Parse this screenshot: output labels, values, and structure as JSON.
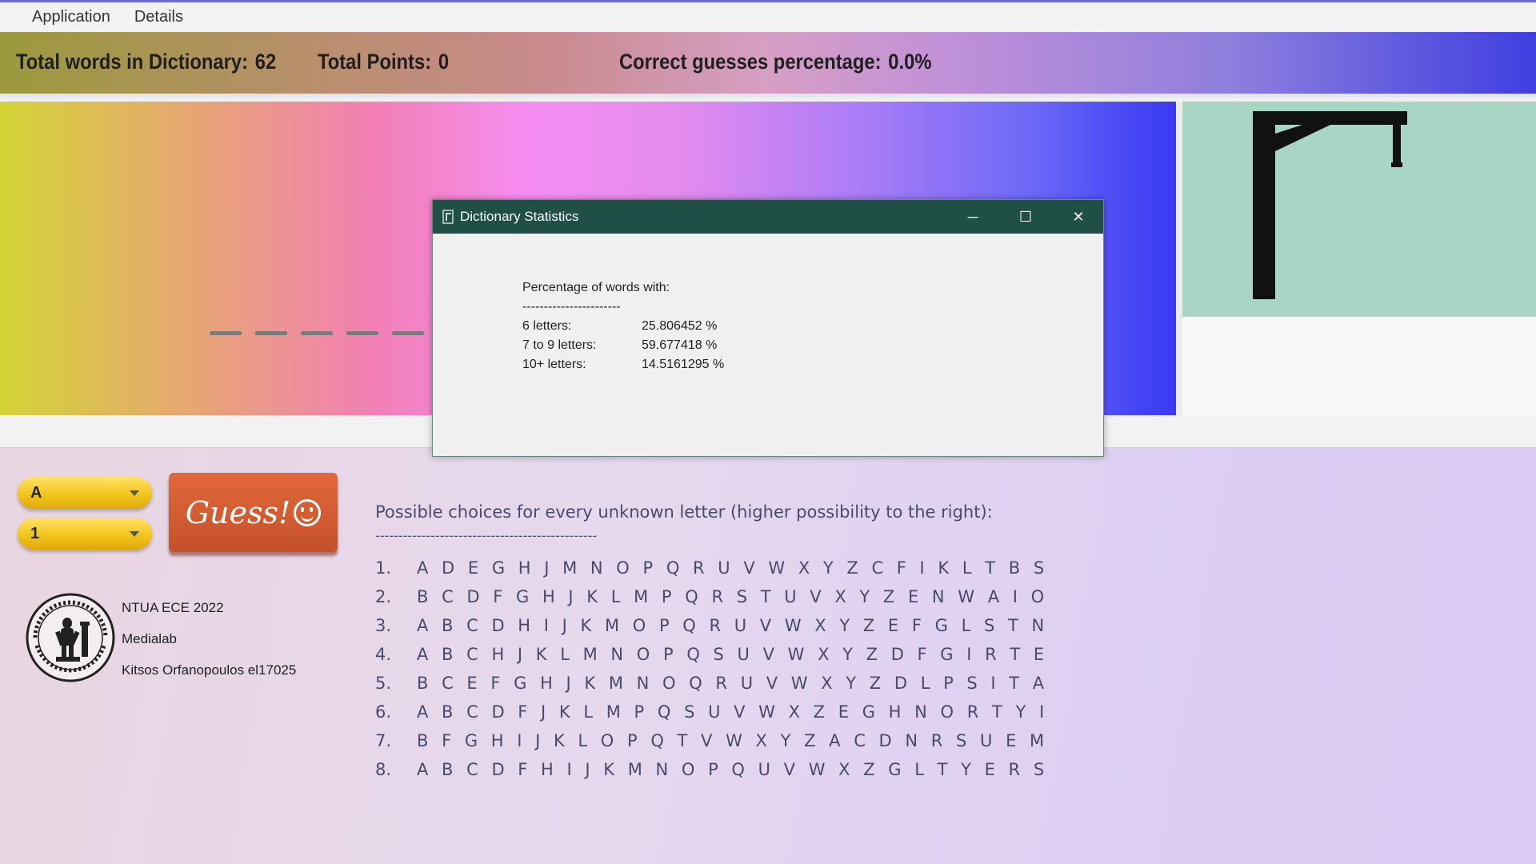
{
  "menu": {
    "items": [
      "Application",
      "Details"
    ]
  },
  "stats": {
    "words_label": "Total words in Dictionary:",
    "words_value": "62",
    "points_label": "Total Points:",
    "points_value": "0",
    "percent_label": "Correct guesses percentage:",
    "percent_value": "0.0%"
  },
  "word": {
    "dash_count": 5
  },
  "controls": {
    "letter_value": "A",
    "position_value": "1",
    "guess_label": "Guess!"
  },
  "credits": {
    "line1": "NTUA ECE 2022",
    "line2": "Medialab",
    "line3": "Kitsos Orfanopoulos el17025"
  },
  "choices": {
    "title": "Possible choices for every unknown letter (higher possibility to the right):",
    "separator": "------------------------------------------------",
    "rows": [
      {
        "num": "1.",
        "letters": "A D E G H J M N O P Q R U V W X Y Z C F I K L T B S"
      },
      {
        "num": "2.",
        "letters": "B C D F G H J K L M P Q R S T U V X Y Z E N W A I O"
      },
      {
        "num": "3.",
        "letters": "A B C D H I J K M O P Q R U V W X Y Z E F G L S T N"
      },
      {
        "num": "4.",
        "letters": "A B C H J K L M N O P Q S U V W X Y Z D F G I R T E"
      },
      {
        "num": "5.",
        "letters": "B C E F G H J K M N O Q R U V W X Y Z D L P S I T A"
      },
      {
        "num": "6.",
        "letters": "A B C D F J K L M P Q S U V W X Z E G H N O R T Y I"
      },
      {
        "num": "7.",
        "letters": "B F G H I J K L O P Q T V W X Y Z A C D N R S U E M"
      },
      {
        "num": "8.",
        "letters": "A B C D F H I J K M N O P Q U V W X Z G L T Y E R S"
      }
    ]
  },
  "dialog": {
    "title": "Dictionary Statistics",
    "heading": "Percentage of words with:",
    "separator": "-----------------------",
    "rows": [
      {
        "label": "6 letters:",
        "value": "25.806452 %"
      },
      {
        "label": "7 to 9 letters:",
        "value": "59.677418 %"
      },
      {
        "label": "10+ letters:",
        "value": "14.5161295 %"
      }
    ],
    "minimize": "─",
    "maximize": "☐",
    "close": "✕"
  }
}
